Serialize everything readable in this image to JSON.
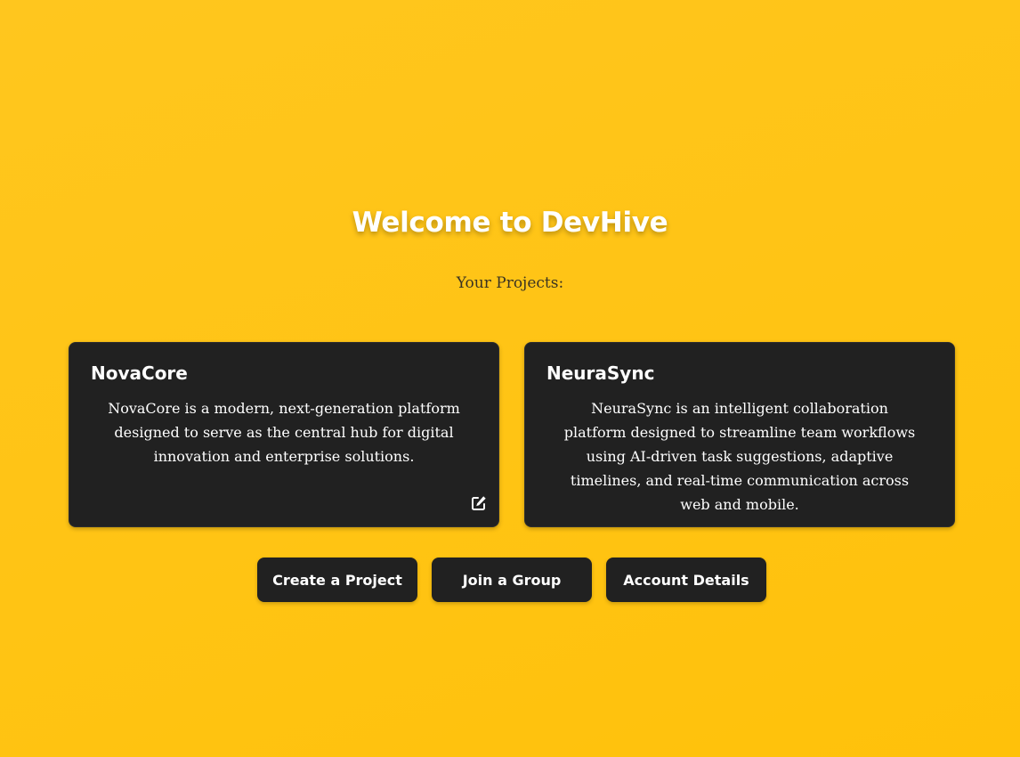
{
  "header": {
    "title": "Welcome to DevHive",
    "subtitle": "Your Projects:"
  },
  "projects": [
    {
      "name": "NovaCore",
      "description": "NovaCore is a modern, next-generation platform designed to serve as the central hub for digital innovation and enterprise solutions.",
      "icon": "edit-icon"
    },
    {
      "name": "NeuraSync",
      "description": "NeuraSync is an intelligent collaboration platform designed to streamline team workflows using AI-driven task suggestions, adaptive timelines, and real-time communication across web and mobile."
    }
  ],
  "actions": {
    "create_label": "Create a Project",
    "join_label": "Join a Group",
    "account_label": "Account Details"
  },
  "colors": {
    "background": "#ffc414",
    "card": "#212121",
    "text_light": "#ffffff"
  }
}
